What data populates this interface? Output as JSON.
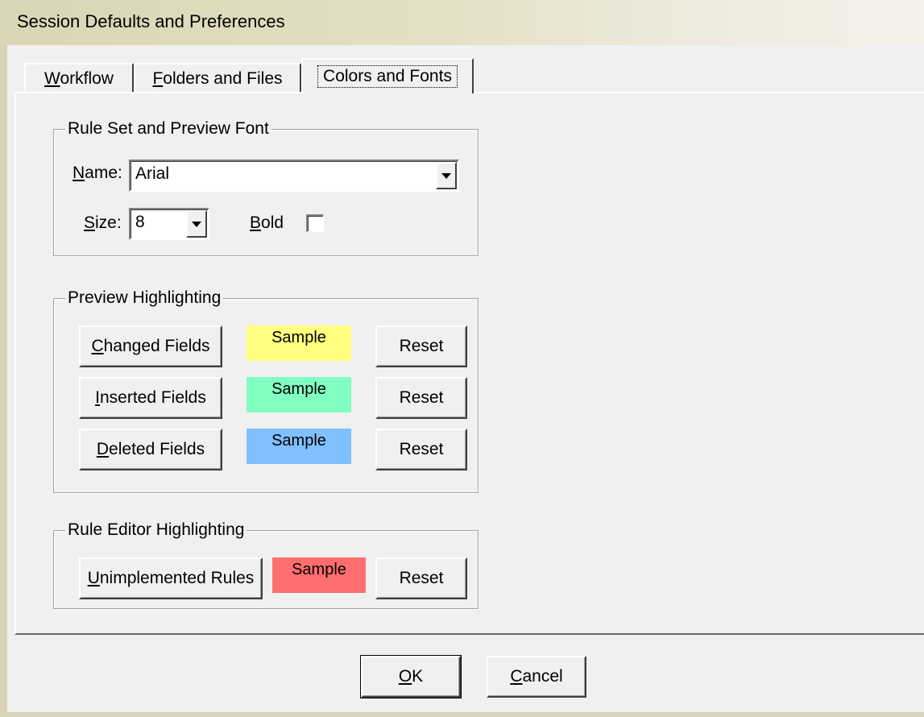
{
  "window": {
    "title": "Session Defaults and Preferences"
  },
  "tabs": [
    {
      "label": "Workflow",
      "mnemonic": "W",
      "rest": "orkflow"
    },
    {
      "label": "Folders and Files",
      "mnemonic": "F",
      "rest": "olders and Files"
    },
    {
      "label": "Colors and Fonts",
      "mnemonic": "",
      "rest": "Colors and Fonts",
      "active": true
    }
  ],
  "font_group": {
    "legend": "Rule Set and Preview Font",
    "name_label": {
      "mnemonic": "N",
      "rest": "ame:"
    },
    "name_value": "Arial",
    "size_label": {
      "mnemonic": "S",
      "rest": "ize:"
    },
    "size_value": "8",
    "bold_label": {
      "mnemonic": "B",
      "rest": "old"
    },
    "bold_checked": false
  },
  "preview_group": {
    "legend": "Preview Highlighting",
    "rows": [
      {
        "button": {
          "before": "",
          "mnemonic": "C",
          "rest": "hanged Fields"
        },
        "sample": "Sample",
        "color": "#ffff80",
        "reset": "Reset"
      },
      {
        "button": {
          "before": "",
          "mnemonic": "I",
          "rest": "nserted Fields"
        },
        "sample": "Sample",
        "color": "#80ffc0",
        "reset": "Reset"
      },
      {
        "button": {
          "before": "",
          "mnemonic": "D",
          "rest": "eleted Fields"
        },
        "sample": "Sample",
        "color": "#80c0ff",
        "reset": "Reset"
      }
    ]
  },
  "rule_editor_group": {
    "legend": "Rule Editor Highlighting",
    "button": {
      "before": "",
      "mnemonic": "U",
      "rest": "nimplemented Rules"
    },
    "sample": "Sample",
    "color": "#ff6e6e",
    "reset": "Reset"
  },
  "footer": {
    "ok": {
      "mnemonic": "O",
      "rest": "K"
    },
    "cancel": {
      "mnemonic": "C",
      "rest": "ancel"
    }
  }
}
